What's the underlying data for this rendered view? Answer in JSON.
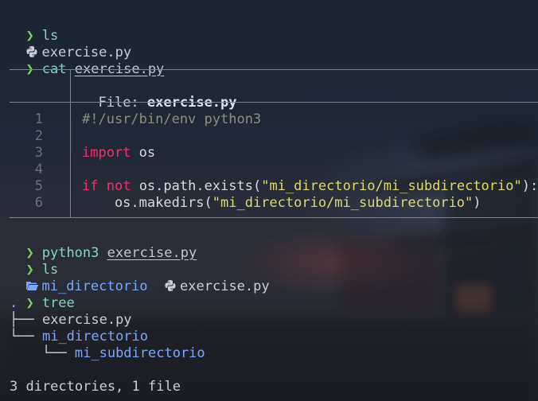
{
  "prompt_symbol": "❯",
  "block1": {
    "cmd": "ls",
    "files": [
      {
        "icon": "python-file-icon",
        "name": "exercise.py"
      }
    ]
  },
  "block2": {
    "cmd": "cat",
    "arg": "exercise.py"
  },
  "bat": {
    "header_label": "File:",
    "header_file": "exercise.py",
    "line_numbers": [
      "1",
      "2",
      "3",
      "4",
      "5",
      "6"
    ],
    "code": {
      "l1": "#!/usr/bin/env python3",
      "l3_kw": "import",
      "l3_rest": " os",
      "l5_kw1": "if",
      "l5_kw2": "not",
      "l5_mid": " os.path.exists(",
      "l5_str": "\"mi_directorio/mi_subdirectorio\"",
      "l5_end": "):",
      "l6_pre": "    os.makedirs(",
      "l6_str": "\"mi_directorio/mi_subdirectorio\"",
      "l6_end": ")"
    }
  },
  "block3": {
    "cmd": "python3",
    "arg": "exercise.py"
  },
  "block4": {
    "cmd": "ls",
    "dir": "mi_directorio",
    "file": "exercise.py"
  },
  "block5": {
    "cmd": "tree",
    "root": ".",
    "t1_prefix": "├── ",
    "t1_name": "exercise.py",
    "t2_prefix": "└── ",
    "t2_name": "mi_directorio",
    "t3_prefix": "    └── ",
    "t3_name": "mi_subdirectorio",
    "summary": "3 directories, 1 file"
  },
  "colors": {
    "prompt": "#7fd06a",
    "command": "#7fd9c3",
    "keyword": "#f0306e",
    "string": "#e3d96a",
    "directory": "#7aa7ff"
  }
}
